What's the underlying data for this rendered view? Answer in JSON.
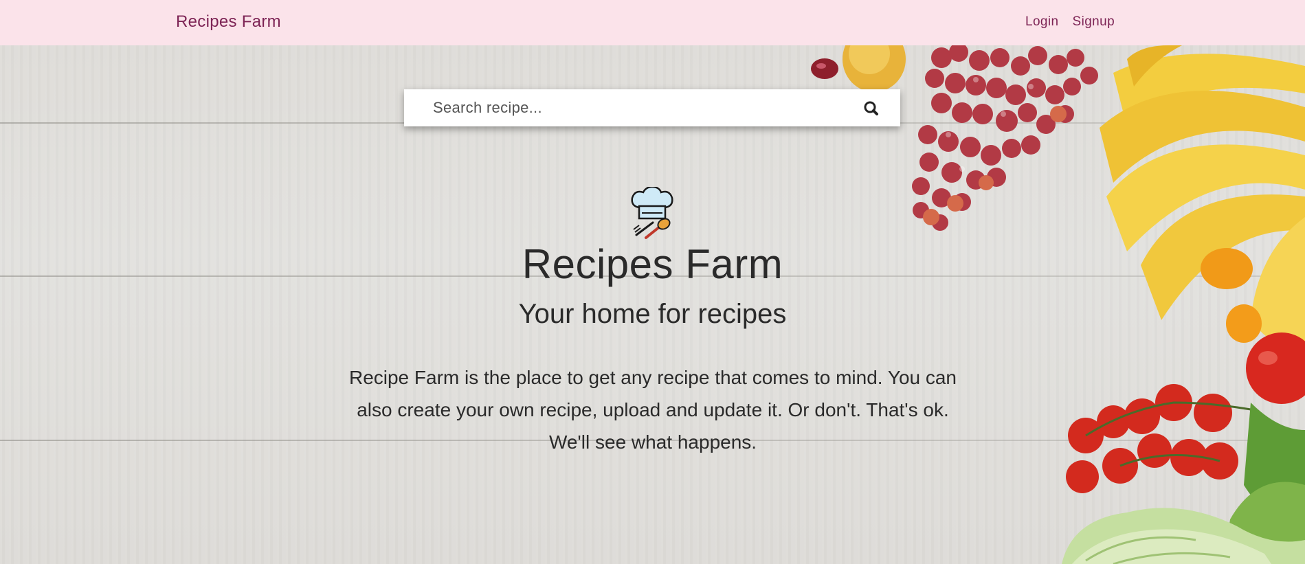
{
  "navbar": {
    "brand": "Recipes Farm",
    "links": [
      {
        "label": "Login"
      },
      {
        "label": "Signup"
      }
    ]
  },
  "search": {
    "placeholder": "Search recipe...",
    "icon": "search-icon"
  },
  "hero": {
    "icon": "chef-hat-icon",
    "title": "Recipes Farm",
    "subtitle": "Your home for recipes",
    "description_lines": [
      "Recipe Farm is the place to get any recipe that comes to mind. You can",
      "also create your own recipe, upload and update it. Or don't. That's ok.",
      "We'll see what happens."
    ]
  },
  "colors": {
    "navbar_bg": "#fbe3ea",
    "brand_text": "#7d2455",
    "heading_text": "#2a2a2a",
    "background_wood": "#e2e1de"
  }
}
